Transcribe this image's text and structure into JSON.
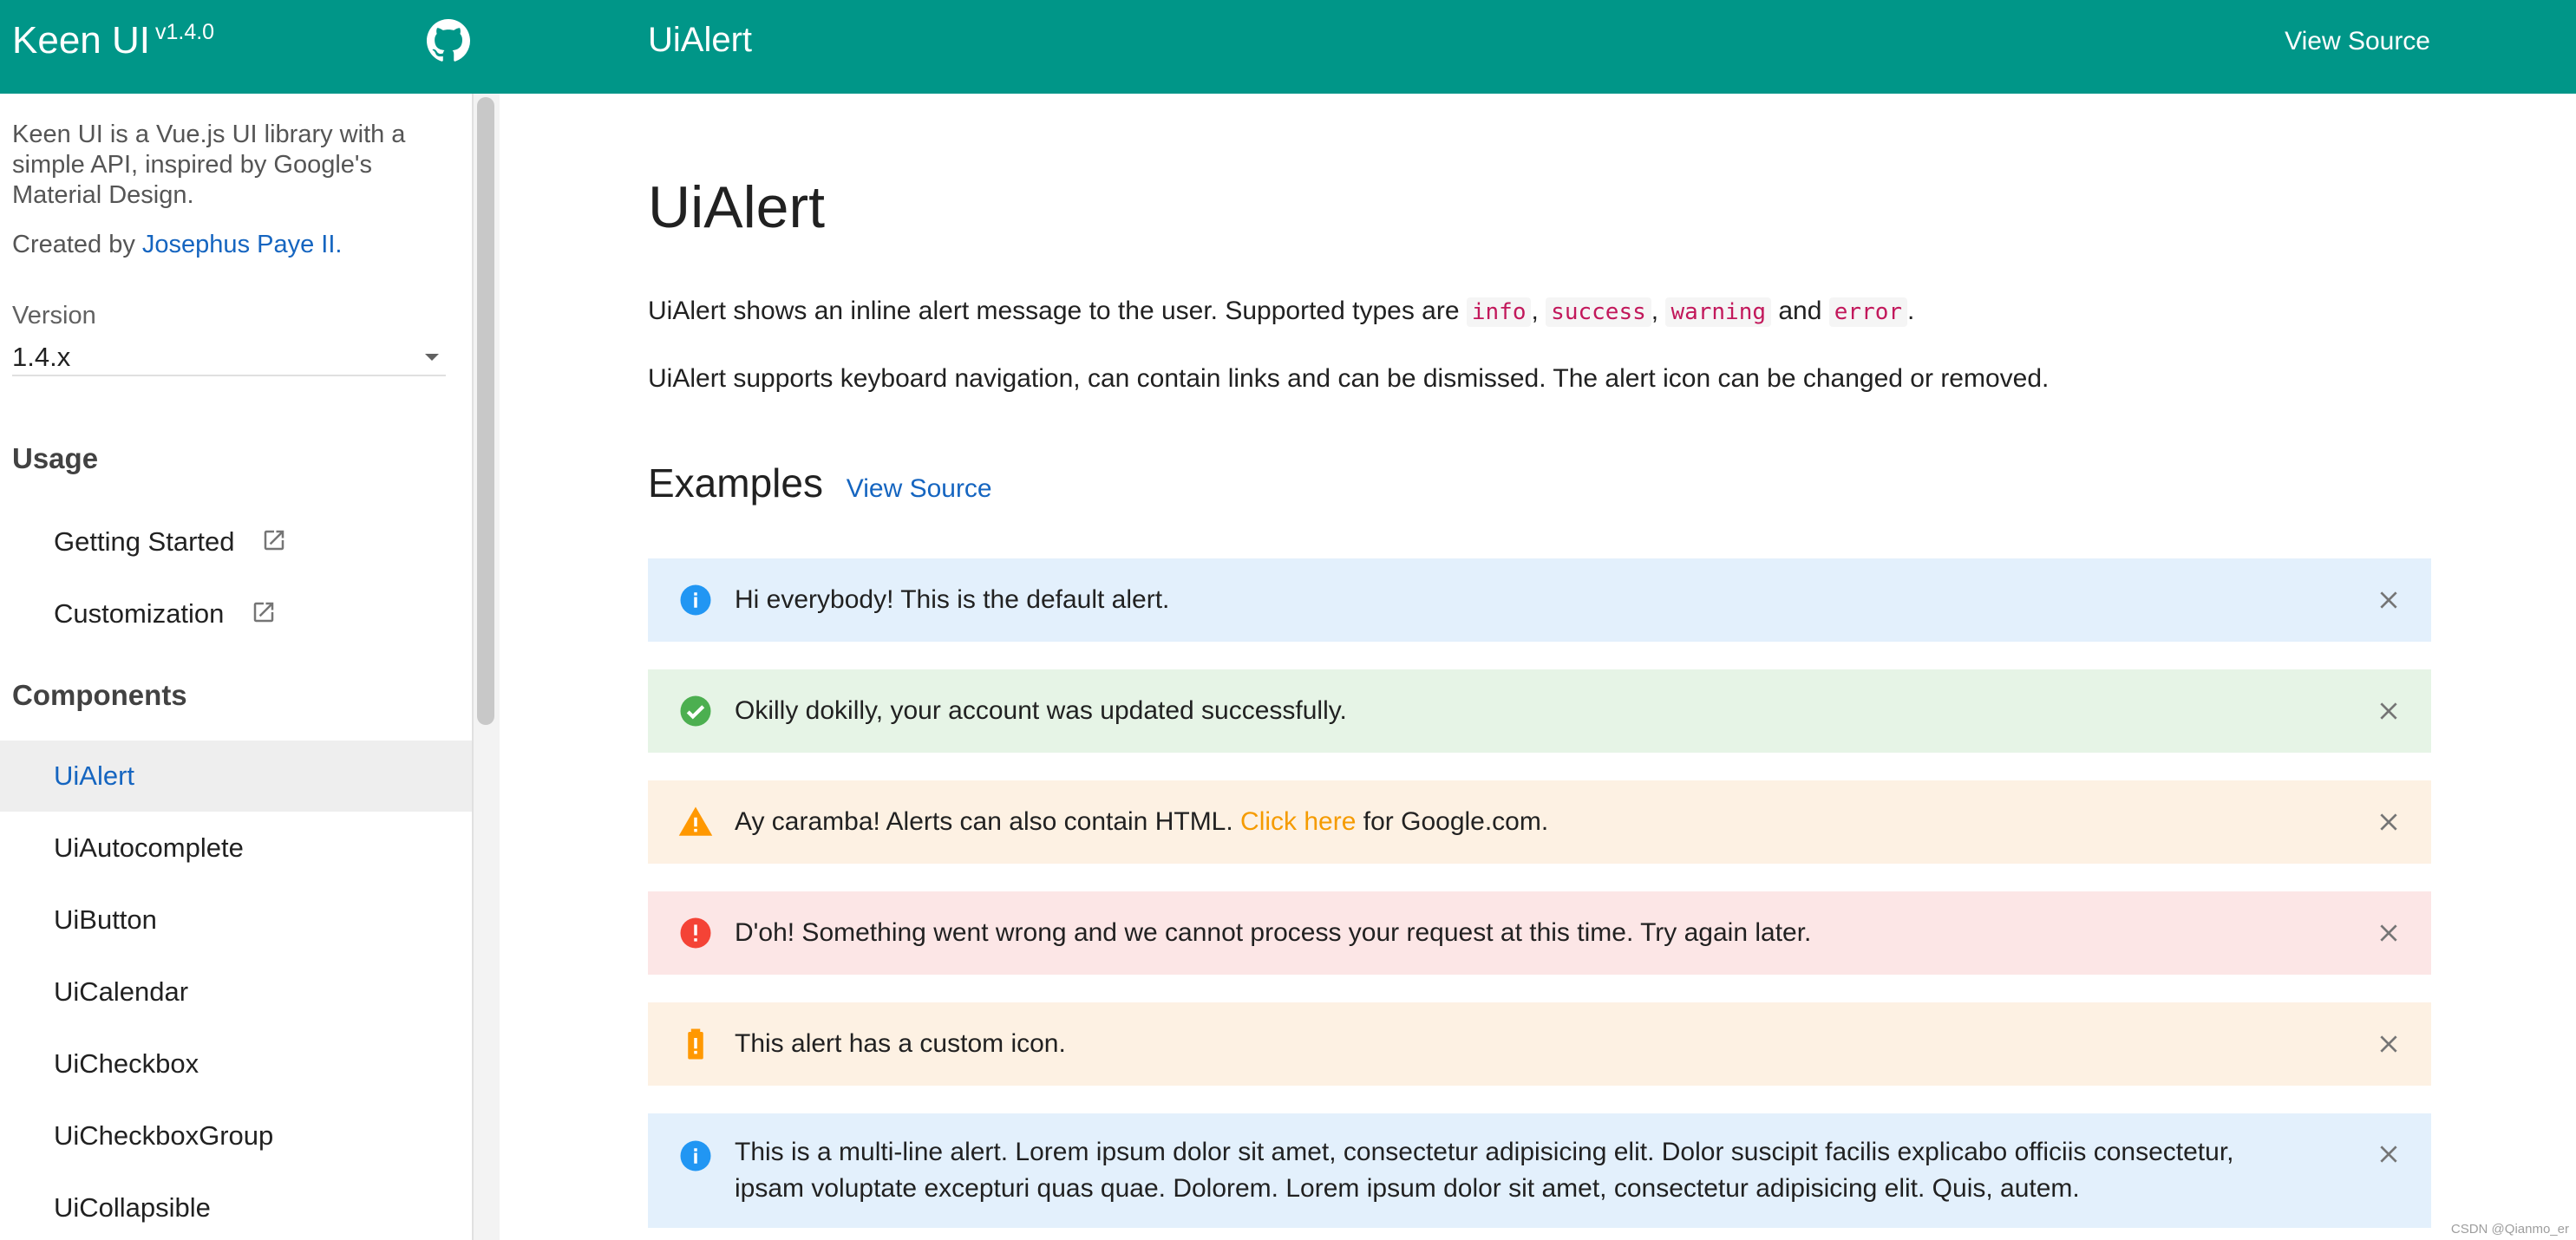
{
  "header": {
    "brand": "Keen UI",
    "version": "v1.4.0",
    "page_title": "UiAlert",
    "view_source": "View Source"
  },
  "sidebar": {
    "description": "Keen UI is a Vue.js UI library with a simple API, inspired by Google's Material Design.",
    "created_by_prefix": "Created by",
    "author": "Josephus Paye II.",
    "version_label": "Version",
    "version_value": "1.4.x",
    "sections": {
      "usage": "Usage",
      "components": "Components"
    },
    "usage_items": [
      "Getting Started",
      "Customization"
    ],
    "component_items": [
      "UiAlert",
      "UiAutocomplete",
      "UiButton",
      "UiCalendar",
      "UiCheckbox",
      "UiCheckboxGroup",
      "UiCollapsible"
    ],
    "active_item": "UiAlert"
  },
  "main": {
    "title": "UiAlert",
    "intro_prefix": "UiAlert shows an inline alert message to the user. Supported types are",
    "types": [
      "info",
      "success",
      "warning",
      "error"
    ],
    "sep_comma": ",",
    "sep_and": "and",
    "intro_end": ".",
    "intro2": "UiAlert supports keyboard navigation, can contain links and can be dismissed. The alert icon can be changed or removed.",
    "examples_heading": "Examples",
    "examples_view_source": "View Source",
    "alerts": [
      {
        "type": "info",
        "text": "Hi everybody! This is the default alert."
      },
      {
        "type": "success",
        "text": "Okilly dokilly, your account was updated successfully."
      },
      {
        "type": "warning",
        "text_before": "Ay caramba! Alerts can also contain HTML.",
        "link": "Click here",
        "text_after": "for Google.com."
      },
      {
        "type": "error",
        "text": "D'oh! Something went wrong and we cannot process your request at this time. Try again later."
      },
      {
        "type": "warning",
        "text": "This alert has a custom icon."
      },
      {
        "type": "info",
        "text": "This is a multi-line alert. Lorem ipsum dolor sit amet, consectetur adipisicing elit. Dolor suscipit facilis explicabo officiis consectetur, ipsam voluptate excepturi quas quae. Dolorem. Lorem ipsum dolor sit amet, consectetur adipisicing elit. Quis, autem."
      }
    ]
  },
  "watermark": "CSDN @Qianmo_er",
  "colors": {
    "primary": "#009688",
    "link": "#1565c0",
    "info_icon": "#2196f3",
    "success_icon": "#4caf50",
    "warning_icon": "#ff9800",
    "error_icon": "#f44336"
  },
  "icons": [
    "github-icon",
    "external-link-icon",
    "info-icon",
    "check-circle-icon",
    "warning-icon",
    "error-icon",
    "battery-alert-icon",
    "close-icon",
    "dropdown-caret-icon"
  ]
}
